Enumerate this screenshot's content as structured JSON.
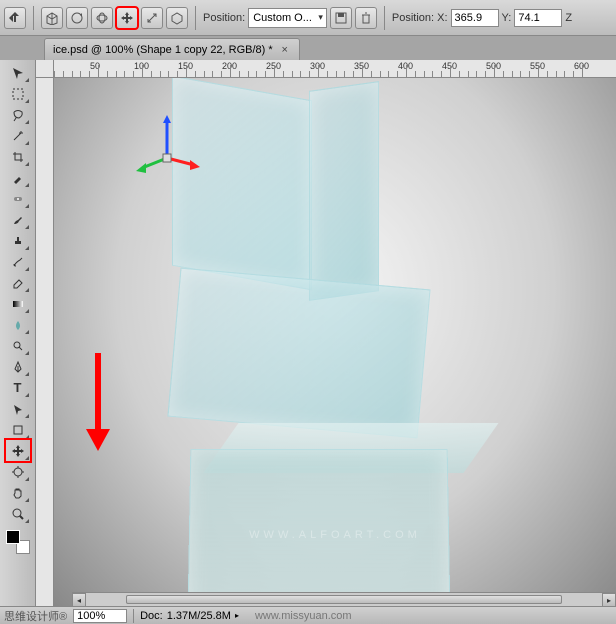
{
  "toolbar": {
    "position_label": "Position:",
    "position_dropdown": "Custom O...",
    "position_x_label": "Position:  X:",
    "x_value": "365.9",
    "y_label": "Y:",
    "y_value": "74.1",
    "z_label": "Z"
  },
  "tab": {
    "title": "ice.psd @ 100% (Shape 1 copy 22, RGB/8) *"
  },
  "ruler": {
    "marks": [
      50,
      100,
      150,
      200,
      250,
      300,
      350,
      400,
      450,
      500,
      550,
      600
    ]
  },
  "watermark": "WWW.ALFOART.COM",
  "watermark2": "www.missyuan.com",
  "status": {
    "zoom": "100%",
    "doc_label": "Doc:",
    "doc_size": "1.37M/25.8M"
  },
  "footer_left": "思维设计师®"
}
